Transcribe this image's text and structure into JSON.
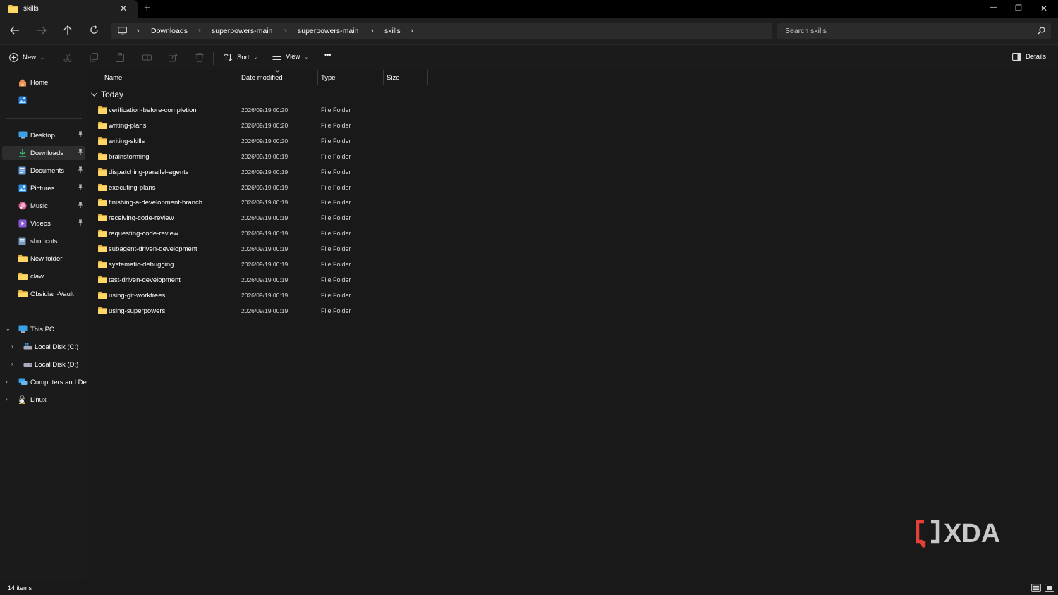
{
  "window": {
    "tab_title": "skills",
    "tab_close_glyph": "✕",
    "new_tab_glyph": "+",
    "minimize_glyph": "—",
    "restore_glyph": "❐",
    "close_glyph": "✕"
  },
  "nav": {
    "breadcrumbs": [
      "Downloads",
      "superpowers-main",
      "superpowers-main",
      "skills"
    ],
    "crumb_sep": "›",
    "search_placeholder": "Search skills"
  },
  "commands": {
    "new_label": "New",
    "sort_label": "Sort",
    "view_label": "View",
    "more_label": "•••",
    "details_label": "Details",
    "chevron": "⌄"
  },
  "sidebar": {
    "home": "Home",
    "quick_access": [
      {
        "label": "Desktop",
        "icon": "desktop-icon",
        "pinned": true
      },
      {
        "label": "Downloads",
        "icon": "download-icon",
        "pinned": true,
        "selected": true
      },
      {
        "label": "Documents",
        "icon": "document-icon",
        "pinned": true
      },
      {
        "label": "Pictures",
        "icon": "pictures-icon",
        "pinned": true
      },
      {
        "label": "Music",
        "icon": "music-icon",
        "pinned": true
      },
      {
        "label": "Videos",
        "icon": "videos-icon",
        "pinned": true
      },
      {
        "label": "shortcuts",
        "icon": "shortcuts-icon",
        "pinned": false
      },
      {
        "label": "New folder",
        "icon": "folder-icon",
        "pinned": false
      },
      {
        "label": "claw",
        "icon": "folder-icon",
        "pinned": false
      },
      {
        "label": "Obsidian-Vault",
        "icon": "folder-icon",
        "pinned": false
      }
    ],
    "pin_glyph": "📌",
    "this_pc": "This PC",
    "local_disk_c": "Local Disk (C:)",
    "local_disk_d": "Local Disk (D:)",
    "computers_devices": "Computers and Devices",
    "linux": "Linux",
    "expand_glyph": "›",
    "collapse_glyph": "⌄"
  },
  "columns": {
    "name": "Name",
    "date_modified": "Date modified",
    "type": "Type",
    "size": "Size"
  },
  "group": {
    "label": "Today",
    "glyph": "⌄"
  },
  "files": [
    {
      "name": "verification-before-completion",
      "date": "2026/09/19 00:20",
      "type": "File Folder"
    },
    {
      "name": "writing-plans",
      "date": "2026/09/19 00:20",
      "type": "File Folder"
    },
    {
      "name": "writing-skills",
      "date": "2026/09/19 00:20",
      "type": "File Folder"
    },
    {
      "name": "brainstorming",
      "date": "2026/09/19 00:19",
      "type": "File Folder"
    },
    {
      "name": "dispatching-parallel-agents",
      "date": "2026/09/19 00:19",
      "type": "File Folder"
    },
    {
      "name": "executing-plans",
      "date": "2026/09/19 00:19",
      "type": "File Folder"
    },
    {
      "name": "finishing-a-development-branch",
      "date": "2026/09/19 00:19",
      "type": "File Folder"
    },
    {
      "name": "receiving-code-review",
      "date": "2026/09/19 00:19",
      "type": "File Folder"
    },
    {
      "name": "requesting-code-review",
      "date": "2026/09/19 00:19",
      "type": "File Folder"
    },
    {
      "name": "subagent-driven-development",
      "date": "2026/09/19 00:19",
      "type": "File Folder"
    },
    {
      "name": "systematic-debugging",
      "date": "2026/09/19 00:19",
      "type": "File Folder"
    },
    {
      "name": "test-driven-development",
      "date": "2026/09/19 00:19",
      "type": "File Folder"
    },
    {
      "name": "using-git-worktrees",
      "date": "2026/09/19 00:19",
      "type": "File Folder"
    },
    {
      "name": "using-superpowers",
      "date": "2026/09/19 00:19",
      "type": "File Folder"
    }
  ],
  "status": {
    "item_count": "14 items"
  },
  "watermark": {
    "text": "XDA"
  },
  "colors": {
    "folder": "#f2c14e",
    "accent": "#4cc2ff",
    "watermark_red": "#e3403a"
  }
}
